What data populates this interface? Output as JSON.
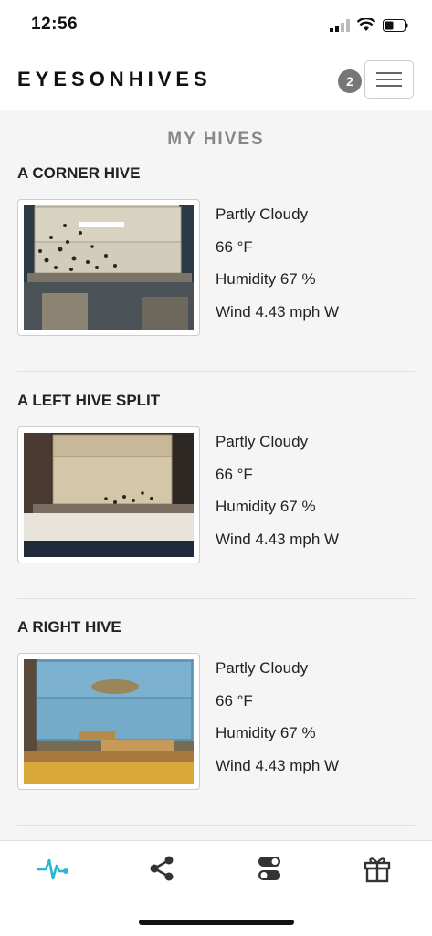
{
  "status": {
    "time": "12:56"
  },
  "header": {
    "brand": "EYESONHIVES",
    "badge_count": "2"
  },
  "section_title": "MY HIVES",
  "hives": [
    {
      "name": "A CORNER HIVE",
      "condition": "Partly Cloudy",
      "temperature": "66 °F",
      "humidity": "Humidity 67 %",
      "wind": "Wind 4.43 mph W"
    },
    {
      "name": "A LEFT HIVE SPLIT",
      "condition": "Partly Cloudy",
      "temperature": "66 °F",
      "humidity": "Humidity 67 %",
      "wind": "Wind 4.43 mph W"
    },
    {
      "name": "A RIGHT HIVE",
      "condition": "Partly Cloudy",
      "temperature": "66 °F",
      "humidity": "Humidity 67 %",
      "wind": "Wind 4.43 mph W"
    }
  ],
  "tabbar": {
    "icons": [
      "activity-icon",
      "share-icon",
      "toggles-icon",
      "gift-icon"
    ],
    "active_color": "#29b6d4",
    "inactive_color": "#333333"
  }
}
